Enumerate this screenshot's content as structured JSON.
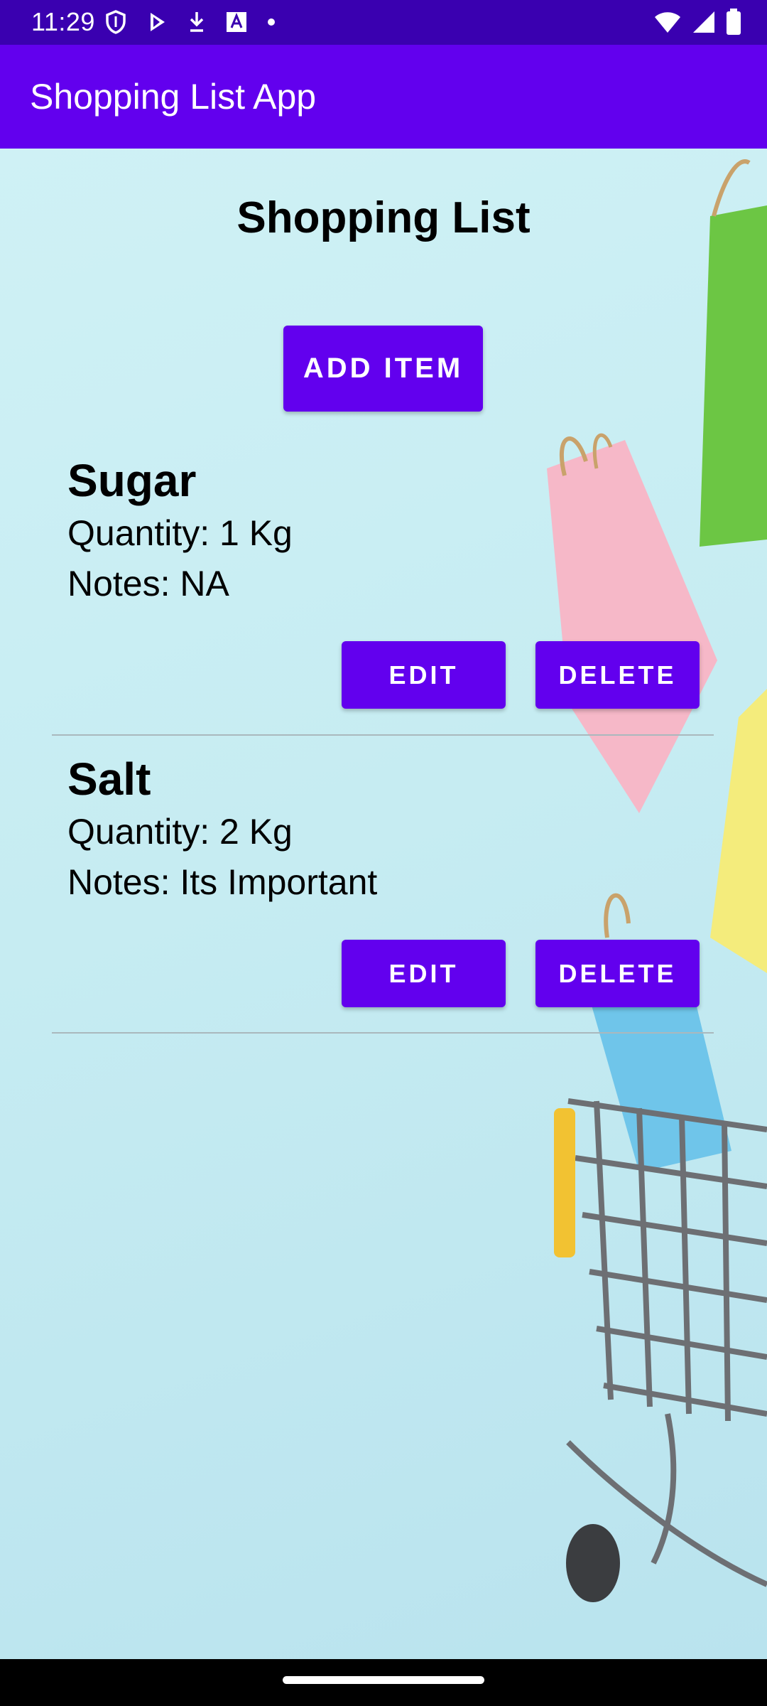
{
  "status_bar": {
    "time": "11:29",
    "left_icons": [
      "shield-icon",
      "play-store-icon",
      "download-icon",
      "font-icon",
      "dot-icon"
    ],
    "right_icons": [
      "wifi-icon",
      "signal-icon",
      "battery-icon"
    ]
  },
  "app_bar": {
    "title": "Shopping List App"
  },
  "main": {
    "title": "Shopping List",
    "add_button_label": "ADD ITEM",
    "items": [
      {
        "name": "Sugar",
        "quantity": "Quantity: 1 Kg",
        "notes": "Notes: NA",
        "edit_label": "EDIT",
        "delete_label": "DELETE"
      },
      {
        "name": "Salt",
        "quantity": "Quantity: 2 Kg",
        "notes": "Notes: Its Important",
        "edit_label": "EDIT",
        "delete_label": "DELETE"
      }
    ]
  },
  "colors": {
    "status_bar": "#3a00b0",
    "app_bar": "#6200ee",
    "button": "#6200ee",
    "background": "#c9eef2"
  },
  "background_image": "shopping-bags-and-cart-image"
}
